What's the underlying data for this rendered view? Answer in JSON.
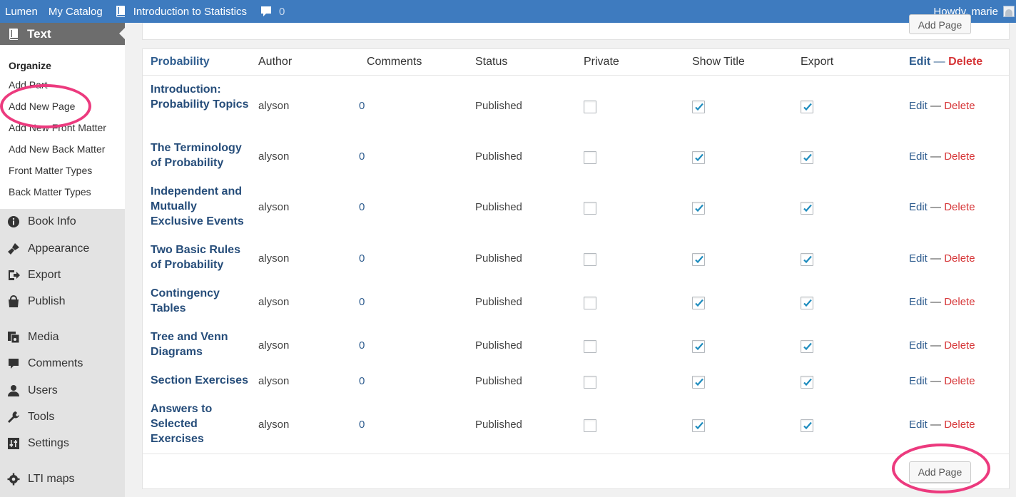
{
  "adminbar": {
    "site": "Lumen",
    "catalog": "My Catalog",
    "book": "Introduction to Statistics",
    "comment_count": "0",
    "greeting": "Howdy, marie"
  },
  "sidebar": {
    "current_section": "Text",
    "submenu": [
      "Organize",
      "Add Part",
      "Add New Page",
      "Add New Front Matter",
      "Add New Back Matter",
      "Front Matter Types",
      "Back Matter Types"
    ],
    "menu": [
      {
        "label": "Book Info",
        "icon": "info-icon"
      },
      {
        "label": "Appearance",
        "icon": "paintbrush-icon"
      },
      {
        "label": "Export",
        "icon": "export-icon"
      },
      {
        "label": "Publish",
        "icon": "cart-icon"
      },
      {
        "label": "Media",
        "icon": "media-icon"
      },
      {
        "label": "Comments",
        "icon": "comment-icon"
      },
      {
        "label": "Users",
        "icon": "user-icon"
      },
      {
        "label": "Tools",
        "icon": "wrench-icon"
      },
      {
        "label": "Settings",
        "icon": "settings-icon"
      },
      {
        "label": "LTI maps",
        "icon": "gear-icon"
      }
    ]
  },
  "table": {
    "headers": {
      "part": "Probability",
      "author": "Author",
      "comments": "Comments",
      "status": "Status",
      "private": "Private",
      "show_title": "Show Title",
      "export": "Export",
      "edit": "Edit",
      "separator": "—",
      "delete": "Delete"
    },
    "rows": [
      {
        "title": "Introduction: Probability Topics",
        "author": "alyson",
        "comments": "0",
        "status": "Published",
        "private": false,
        "show_title": true,
        "export": true
      },
      {
        "title": "The Terminology of Probability",
        "author": "alyson",
        "comments": "0",
        "status": "Published",
        "private": false,
        "show_title": true,
        "export": true
      },
      {
        "title": "Independent and Mutually Exclusive Events",
        "author": "alyson",
        "comments": "0",
        "status": "Published",
        "private": false,
        "show_title": true,
        "export": true
      },
      {
        "title": "Two Basic Rules of Probability",
        "author": "alyson",
        "comments": "0",
        "status": "Published",
        "private": false,
        "show_title": true,
        "export": true
      },
      {
        "title": "Contingency Tables",
        "author": "alyson",
        "comments": "0",
        "status": "Published",
        "private": false,
        "show_title": true,
        "export": true
      },
      {
        "title": "Tree and Venn Diagrams",
        "author": "alyson",
        "comments": "0",
        "status": "Published",
        "private": false,
        "show_title": true,
        "export": true
      },
      {
        "title": "Section Exercises",
        "author": "alyson",
        "comments": "0",
        "status": "Published",
        "private": false,
        "show_title": true,
        "export": true
      },
      {
        "title": "Answers to Selected Exercises",
        "author": "alyson",
        "comments": "0",
        "status": "Published",
        "private": false,
        "show_title": true,
        "export": true
      }
    ],
    "row_actions": {
      "edit": "Edit",
      "separator": "—",
      "delete": "Delete"
    },
    "add_page_button": "Add Page"
  },
  "colors": {
    "adminbar": "#3e7bbf",
    "link": "#264d7a",
    "delete": "#d63638",
    "highlight_ring": "#ec3a7e"
  }
}
